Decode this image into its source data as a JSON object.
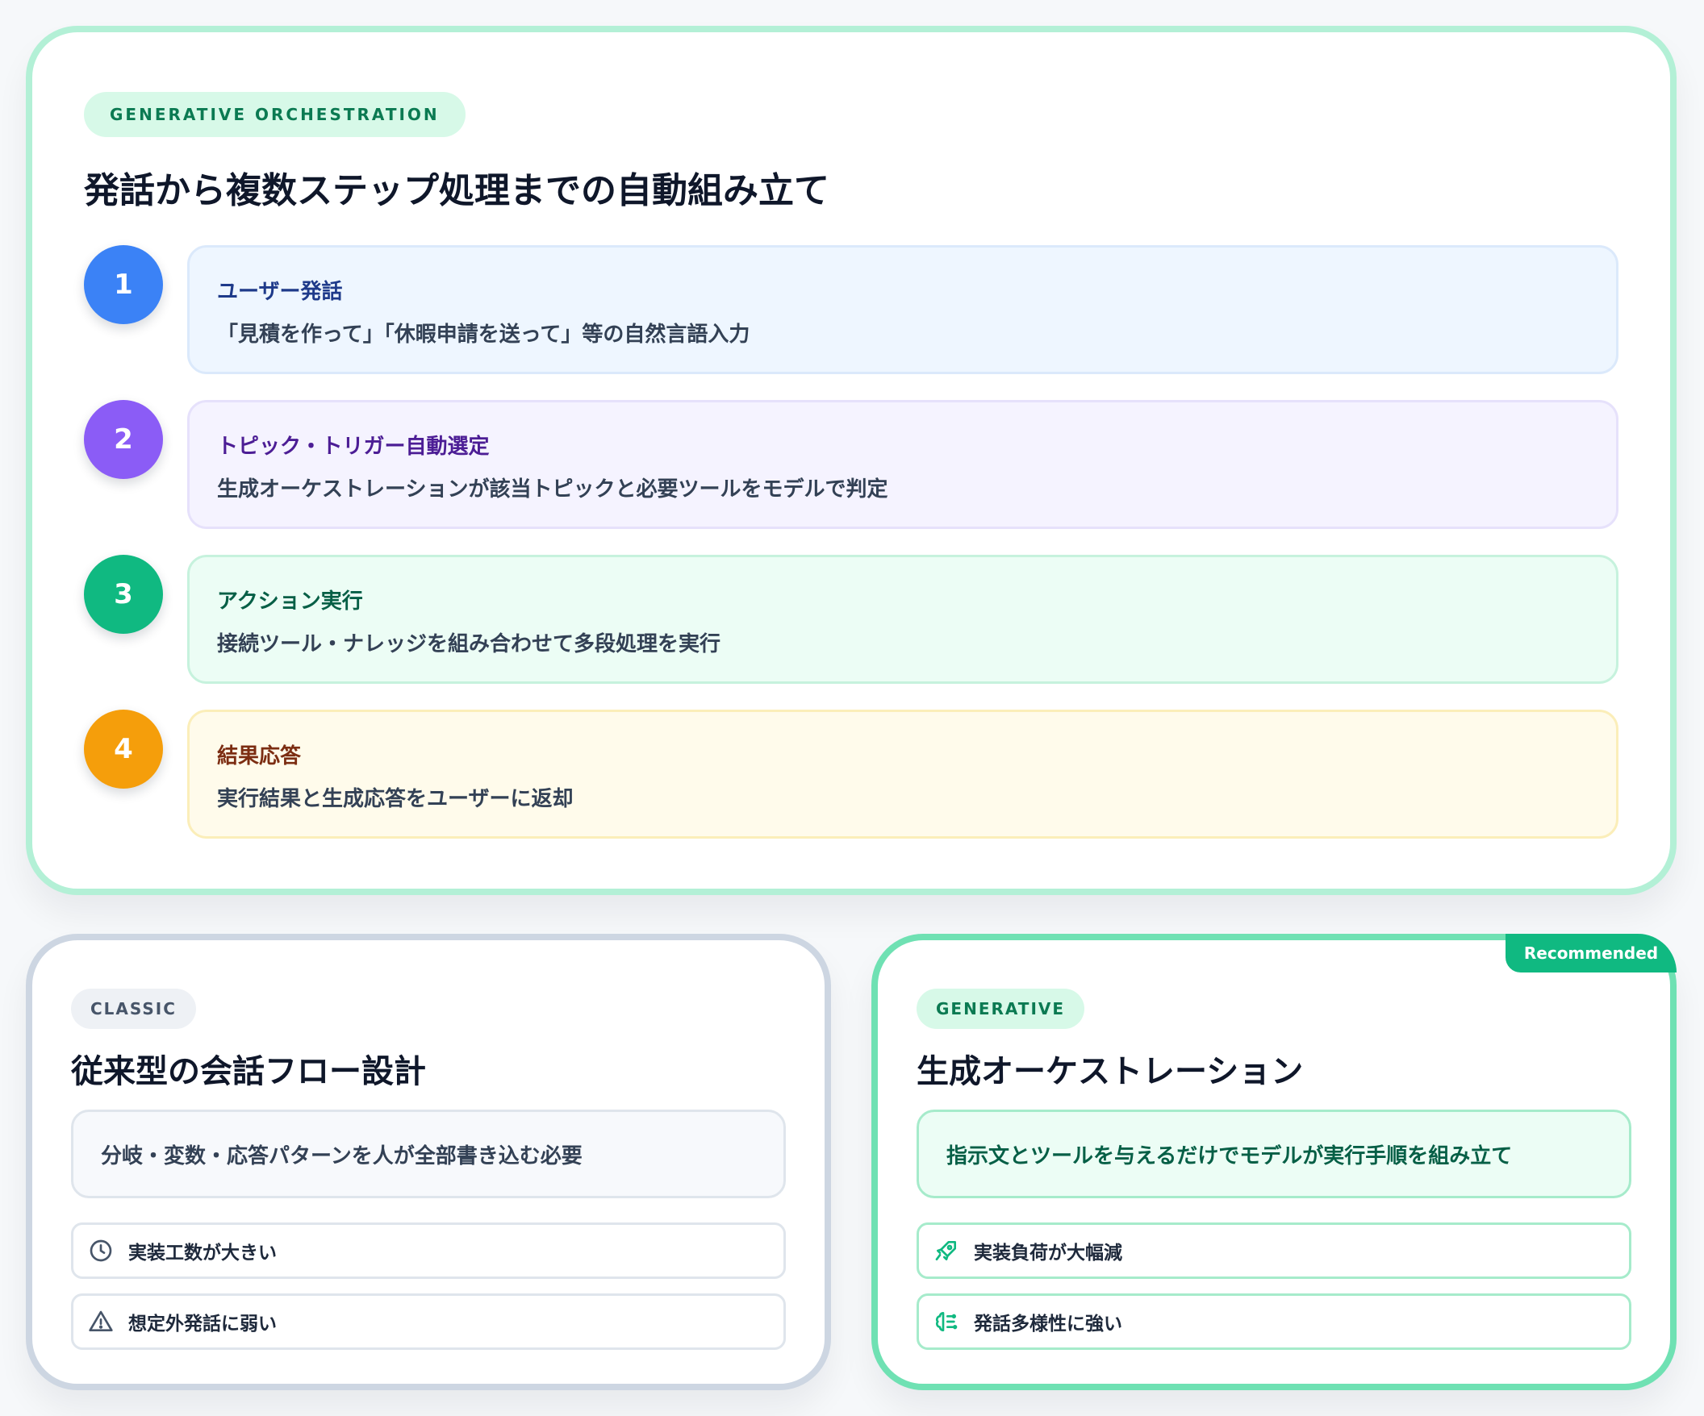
{
  "orchestration": {
    "tag": "GENERATIVE ORCHESTRATION",
    "title": "発話から複数ステップ処理までの自動組み立て",
    "steps": [
      {
        "number": "1",
        "title": "ユーザー発話",
        "description": "「見積を作って」「休暇申請を送って」等の自然言語入力",
        "accent": "#3b82f6",
        "bg": "#eef6ff",
        "border": "#dbe9fb",
        "title_color": "#1e3a8a"
      },
      {
        "number": "2",
        "title": "トピック・トリガー自動選定",
        "description": "生成オーケストレーションが該当トピックと必要ツールをモデルで判定",
        "accent": "#8b5cf6",
        "bg": "#f5f3ff",
        "border": "#e6e1fb",
        "title_color": "#4c1d95"
      },
      {
        "number": "3",
        "title": "アクション実行",
        "description": "接続ツール・ナレッジを組み合わせて多段処理を実行",
        "accent": "#10b981",
        "bg": "#ecfdf5",
        "border": "#c6f2dd",
        "title_color": "#065f46"
      },
      {
        "number": "4",
        "title": "結果応答",
        "description": "実行結果と生成応答をユーザーに返却",
        "accent": "#f59e0b",
        "bg": "#fffbeb",
        "border": "#fbeeb9",
        "title_color": "#7c2d12"
      }
    ]
  },
  "classic": {
    "tag": "CLASSIC",
    "title": "従来型の会話フロー設計",
    "statement": "分岐・変数・応答パターンを人が全部書き込む必要",
    "features": [
      {
        "icon": "clock-icon",
        "label": "実装工数が大きい"
      },
      {
        "icon": "warning-icon",
        "label": "想定外発話に弱い"
      }
    ]
  },
  "generative": {
    "badge": "Recommended",
    "tag": "GENERATIVE",
    "title": "生成オーケストレーション",
    "statement": "指示文とツールを与えるだけでモデルが実行手順を組み立て",
    "features": [
      {
        "icon": "rocket-icon",
        "label": "実装負荷が大幅減"
      },
      {
        "icon": "brain-icon",
        "label": "発話多様性に強い"
      }
    ]
  },
  "colors": {
    "brand_green": "#10b981",
    "top_border": "#b3f0d6",
    "classic_border": "#cdd6e2",
    "generative_border": "#6fe1b3"
  }
}
